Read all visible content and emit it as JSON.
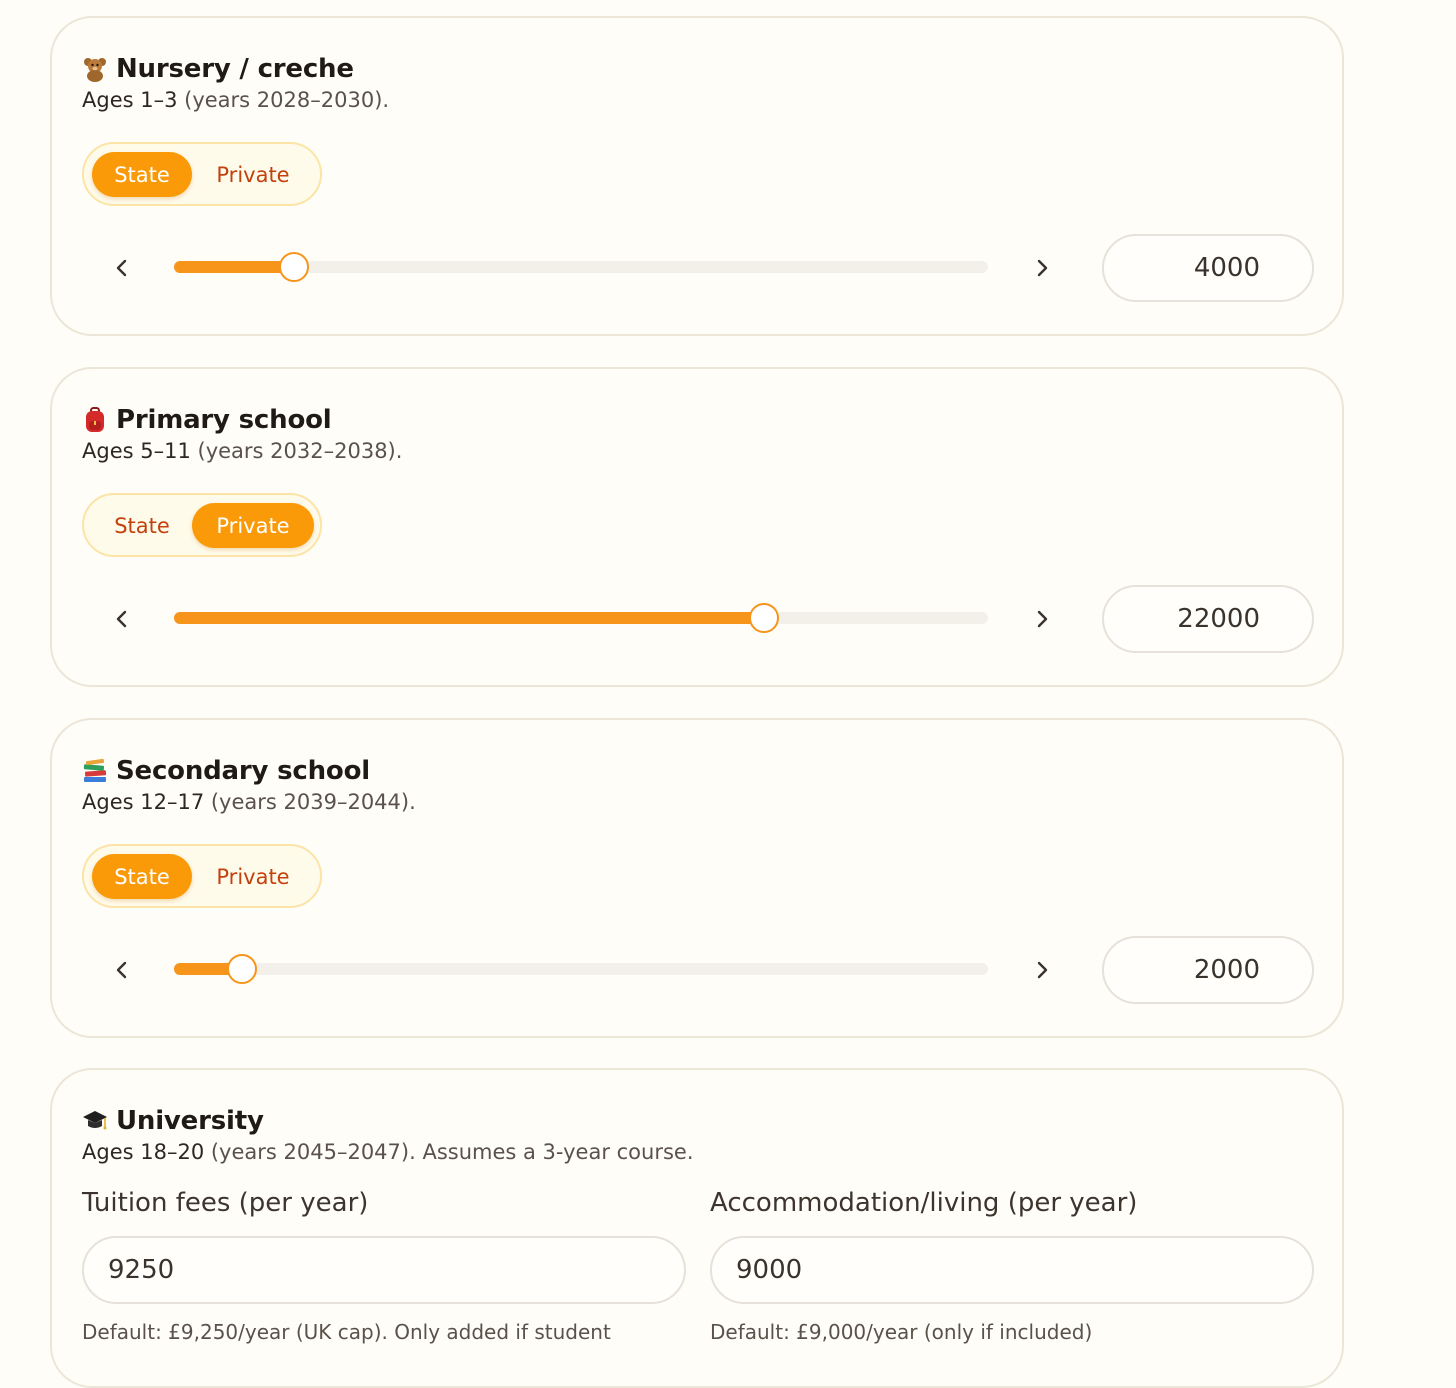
{
  "sections": [
    {
      "icon": "teddy-bear-icon",
      "title": "Nursery / creche",
      "subtitle_bold": "Ages 1–3",
      "subtitle_rest": " (years 2028–2030).",
      "options": [
        "State",
        "Private"
      ],
      "selected": "State",
      "value": "4000",
      "slider_fraction": 0.147
    },
    {
      "icon": "backpack-icon",
      "title": "Primary school",
      "subtitle_bold": "Ages 5–11",
      "subtitle_rest": " (years 2032–2038).",
      "options": [
        "State",
        "Private"
      ],
      "selected": "Private",
      "value": "22000",
      "slider_fraction": 0.725
    },
    {
      "icon": "books-icon",
      "title": "Secondary school",
      "subtitle_bold": "Ages 12–17",
      "subtitle_rest": " (years 2039–2044).",
      "options": [
        "State",
        "Private"
      ],
      "selected": "State",
      "value": "2000",
      "slider_fraction": 0.083
    }
  ],
  "university": {
    "icon": "graduation-cap-icon",
    "title": "University",
    "subtitle_bold": "Ages 18–20",
    "subtitle_rest": " (years 2045–2047). Assumes a 3-year course.",
    "tuition_label": "Tuition fees (per year)",
    "tuition_value": "9250",
    "tuition_help": "Default: £9,250/year (UK cap). Only added if student",
    "accommodation_label": "Accommodation/living (per year)",
    "accommodation_value": "9000",
    "accommodation_help": "Default: £9,000/year (only if included)"
  },
  "colors": {
    "accent": "#fb9a09",
    "accent_text": "#c2410c",
    "background": "#fffdf7"
  }
}
